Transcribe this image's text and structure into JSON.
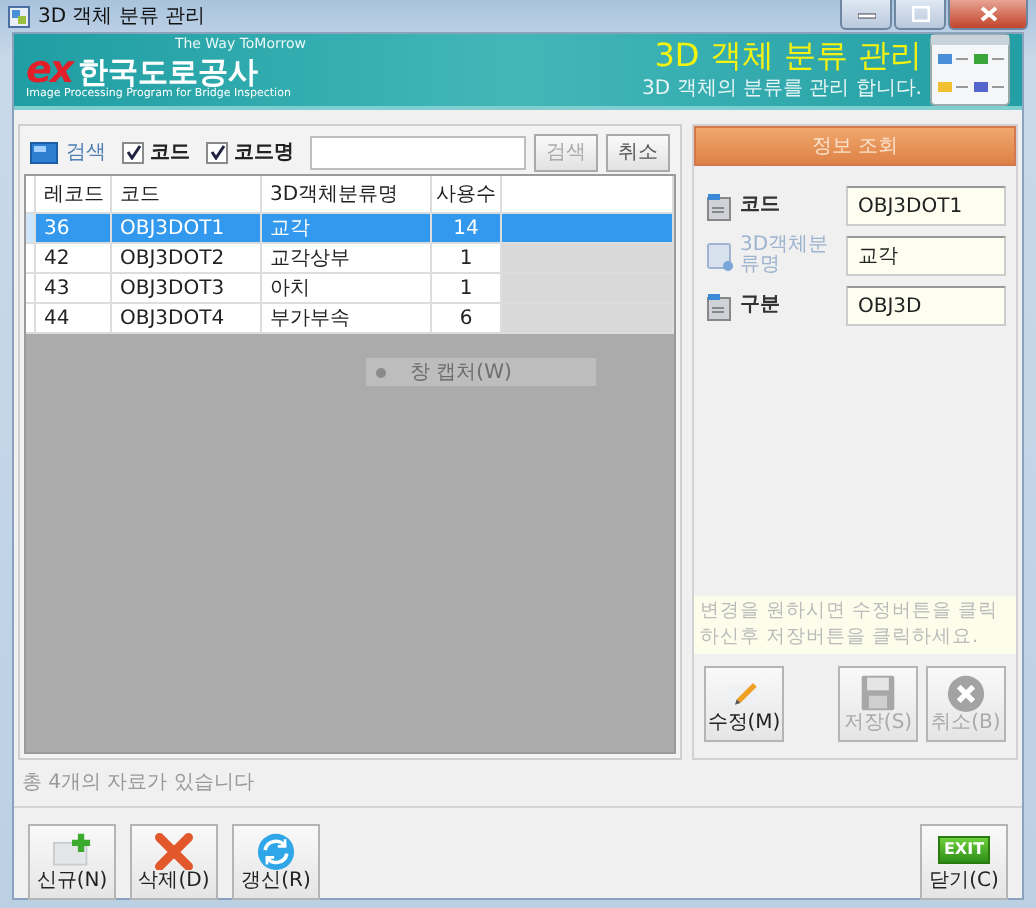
{
  "window": {
    "title": "3D 객체 분류 관리"
  },
  "banner": {
    "tagline": "The Way ToMorrow",
    "logo_mark": "ex",
    "company": "한국도로공사",
    "program": "Image Processing Program for Bridge Inspection",
    "title": "3D 객체 분류 관리",
    "subtitle": "3D 객체의 분류를 관리 합니다."
  },
  "search": {
    "label": "검색",
    "options": [
      {
        "label": "코드",
        "checked": true
      },
      {
        "label": "코드명",
        "checked": true
      }
    ],
    "buttons": [
      {
        "label": "검색",
        "disabled": true
      },
      {
        "label": "취소",
        "disabled": false
      }
    ]
  },
  "table": {
    "columns": [
      "레코드",
      "코드",
      "3D객체분류명",
      "사용수"
    ],
    "rows": [
      {
        "cells": [
          "36",
          "OBJ3DOT1",
          "교각",
          "14"
        ],
        "selected": true
      },
      {
        "cells": [
          "42",
          "OBJ3DOT2",
          "교각상부",
          "1"
        ],
        "selected": false
      },
      {
        "cells": [
          "43",
          "OBJ3DOT3",
          "아치",
          "1"
        ],
        "selected": false
      },
      {
        "cells": [
          "44",
          "OBJ3DOT4",
          "부가부속",
          "6"
        ],
        "selected": false
      }
    ]
  },
  "context_menu_item": "창 캡처(W)",
  "status": "총 4개의 자료가 있습니다",
  "info": {
    "title": "정보 조회",
    "fields": [
      {
        "label": "코드",
        "value": "OBJ3DOT1",
        "disabled": false
      },
      {
        "label": "3D객체분류명",
        "value": "교각",
        "disabled": true
      },
      {
        "label": "구분",
        "value": "OBJ3D",
        "disabled": false
      }
    ],
    "note": "변경을 원하시면 수정버튼을 클릭하신후 저장버튼을 클릭하세요.",
    "buttons": [
      {
        "kind": "edit",
        "label": "수정(M)",
        "disabled": false
      },
      {
        "kind": "save",
        "label": "저장(S)",
        "disabled": true
      },
      {
        "kind": "cancel",
        "label": "취소(B)",
        "disabled": true
      }
    ]
  },
  "toolbar": {
    "buttons": [
      {
        "kind": "new",
        "label": "신규(N)"
      },
      {
        "kind": "delete",
        "label": "삭제(D)"
      },
      {
        "kind": "refresh",
        "label": "갱신(R)"
      }
    ],
    "close": {
      "label": "닫기(C)",
      "badge": "EXIT"
    }
  }
}
